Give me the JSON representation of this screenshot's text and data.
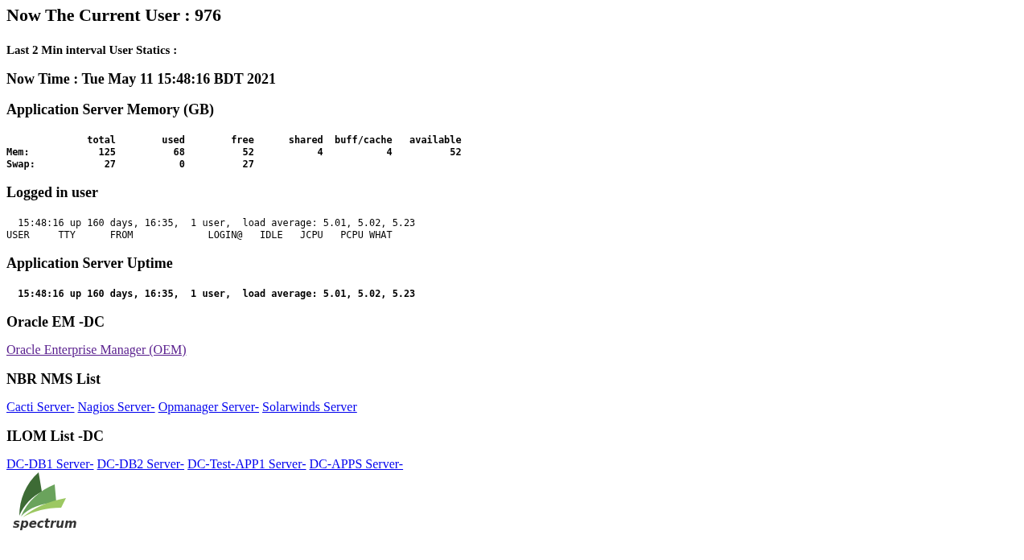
{
  "title": "Now The Current User : 976",
  "subtitle": "Last 2 Min interval User Statics :",
  "sections": [
    {
      "heading": "Now Time : Tue May 11 15:48:16 BDT 2021",
      "kind": "none"
    },
    {
      "heading": "Application Server Memory (GB)",
      "kind": "pre",
      "bold": true,
      "lines": [
        "              total        used        free      shared  buff/cache   available",
        "Mem:            125          68          52           4           4          52",
        "Swap:            27           0          27"
      ]
    },
    {
      "heading": "Logged in user",
      "kind": "pre",
      "bold": false,
      "lines": [
        "  15:48:16 up 160 days, 16:35,  1 user,  load average: 5.01, 5.02, 5.23",
        "USER     TTY      FROM             LOGIN@   IDLE   JCPU   PCPU WHAT"
      ]
    },
    {
      "heading": "Application Server Uptime",
      "kind": "pre",
      "bold": true,
      "lines": [
        "  15:48:16 up 160 days, 16:35,  1 user,  load average: 5.01, 5.02, 5.23"
      ]
    },
    {
      "heading": "Oracle EM -DC",
      "kind": "links",
      "links": [
        {
          "label": "Oracle Enterprise Manager (OEM)",
          "visited": true
        }
      ]
    },
    {
      "heading": "NBR NMS List",
      "kind": "links",
      "links": [
        {
          "label": "Cacti Server-",
          "visited": false
        },
        {
          "label": "Nagios Server-",
          "visited": false
        },
        {
          "label": "Opmanager Server-",
          "visited": false
        },
        {
          "label": "Solarwinds Server",
          "visited": false
        }
      ]
    },
    {
      "heading": "ILOM List -DC",
      "kind": "links",
      "links": [
        {
          "label": "DC-DB1 Server-",
          "visited": false
        },
        {
          "label": "DC-DB2 Server-",
          "visited": false
        },
        {
          "label": "DC-Test-APP1 Server-",
          "visited": false
        },
        {
          "label": "DC-APPS Server-",
          "visited": false
        }
      ]
    }
  ],
  "logo": {
    "text": "spectrum"
  }
}
